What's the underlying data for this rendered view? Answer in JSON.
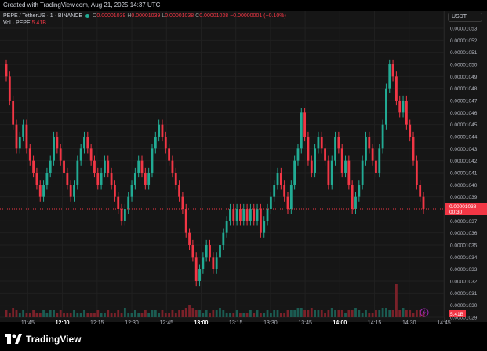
{
  "header": {
    "created_text": "Created with TradingView.com, Aug 21, 2025 14:37 UTC"
  },
  "legend": {
    "symbol": "PEPE / TetherUS · 1 · BINANCE",
    "o_label": "O",
    "o_value": "0.00001039",
    "h_label": "H",
    "h_value": "0.00001039",
    "l_label": "L",
    "l_value": "0.00001038",
    "c_label": "C",
    "c_value": "0.00001038",
    "change": "−0.00000001 (−0.10%)",
    "vol_label": "Vol · PEPE",
    "vol_value": "5.41B"
  },
  "currency_button": "USDT",
  "footer": {
    "brand": "TradingView"
  },
  "colors": {
    "up": "#22ab94",
    "down": "#f23645",
    "background": "#161616",
    "grid": "#202020",
    "price_line": "#f23645",
    "text": "#d1d4dc"
  },
  "icons": {
    "logo": "tradingview-logo-icon",
    "alert": "lightning-icon"
  },
  "chart_data": {
    "type": "candlestick",
    "y_axis": {
      "min": 1.029e-05,
      "max": 1.053e-05,
      "ticks": [
        "0.00001053",
        "0.00001052",
        "0.00001051",
        "0.00001050",
        "0.00001049",
        "0.00001048",
        "0.00001047",
        "0.00001046",
        "0.00001045",
        "0.00001044",
        "0.00001043",
        "0.00001042",
        "0.00001041",
        "0.00001040",
        "0.00001039",
        "0.00001037",
        "0.00001036",
        "0.00001035",
        "0.00001034",
        "0.00001033",
        "0.00001032",
        "0.00001031",
        "0.00001030",
        "0.00001029"
      ]
    },
    "x_axis": {
      "start": "11:33",
      "end": "14:45",
      "ticks": [
        {
          "label": "11:45",
          "bold": false
        },
        {
          "label": "12:00",
          "bold": true
        },
        {
          "label": "12:15",
          "bold": false
        },
        {
          "label": "12:30",
          "bold": false
        },
        {
          "label": "12:45",
          "bold": false
        },
        {
          "label": "13:00",
          "bold": true
        },
        {
          "label": "13:15",
          "bold": false
        },
        {
          "label": "13:30",
          "bold": false
        },
        {
          "label": "13:45",
          "bold": false
        },
        {
          "label": "14:00",
          "bold": true
        },
        {
          "label": "14:15",
          "bold": false
        },
        {
          "label": "14:30",
          "bold": false
        },
        {
          "label": "14:45",
          "bold": false
        }
      ]
    },
    "last_price": {
      "value": 1.038e-05,
      "label": "0.00001038",
      "countdown": "00:30"
    },
    "volume_label": "5.41B",
    "series": {
      "close": [
        1049,
        1047,
        1045,
        1043,
        1044,
        1045,
        1043,
        1042,
        1041,
        1040,
        1039,
        1040,
        1041,
        1042,
        1044,
        1043,
        1042,
        1041,
        1040,
        1039,
        1040,
        1042,
        1043,
        1044,
        1043,
        1042,
        1041,
        1040,
        1041,
        1042,
        1041,
        1040,
        1039,
        1038,
        1037,
        1038,
        1039,
        1040,
        1041,
        1042,
        1041,
        1040,
        1041,
        1043,
        1044,
        1045,
        1044,
        1043,
        1042,
        1041,
        1040,
        1039,
        1038,
        1036,
        1035,
        1034,
        1032,
        1033,
        1034,
        1035,
        1034,
        1033,
        1034,
        1035,
        1036,
        1037,
        1038,
        1037,
        1038,
        1037,
        1038,
        1037,
        1038,
        1037,
        1038,
        1036,
        1037,
        1038,
        1039,
        1040,
        1041,
        1040,
        1039,
        1038,
        1040,
        1042,
        1043,
        1046,
        1044,
        1042,
        1041,
        1043,
        1044,
        1043,
        1042,
        1040,
        1042,
        1044,
        1043,
        1041,
        1042,
        1040,
        1038,
        1039,
        1040,
        1042,
        1044,
        1043,
        1042,
        1041,
        1043,
        1045,
        1048,
        1050,
        1049,
        1047,
        1046,
        1047,
        1045,
        1044,
        1042,
        1040,
        1039,
        1038
      ],
      "volume": [
        3,
        2,
        4,
        3,
        2,
        3,
        2,
        2,
        3,
        2,
        2,
        3,
        2,
        3,
        3,
        2,
        3,
        2,
        2,
        2,
        3,
        2,
        2,
        3,
        2,
        2,
        2,
        3,
        2,
        2,
        3,
        2,
        2,
        3,
        2,
        4,
        2,
        2,
        3,
        2,
        2,
        3,
        2,
        3,
        3,
        2,
        3,
        2,
        2,
        3,
        2,
        3,
        3,
        4,
        5,
        4,
        3,
        3,
        2,
        3,
        2,
        3,
        3,
        4,
        3,
        2,
        2,
        2,
        3,
        2,
        2,
        2,
        3,
        2,
        3,
        2,
        2,
        3,
        2,
        3,
        3,
        2,
        2,
        3,
        3,
        3,
        4,
        4,
        3,
        3,
        4,
        3,
        3,
        3,
        2,
        3,
        4,
        3,
        3,
        3,
        2,
        3,
        3,
        4,
        3,
        2,
        3,
        2,
        2,
        3,
        3,
        4,
        4,
        3,
        3,
        14,
        3,
        4,
        3,
        3,
        2,
        3,
        3,
        2
      ]
    }
  }
}
